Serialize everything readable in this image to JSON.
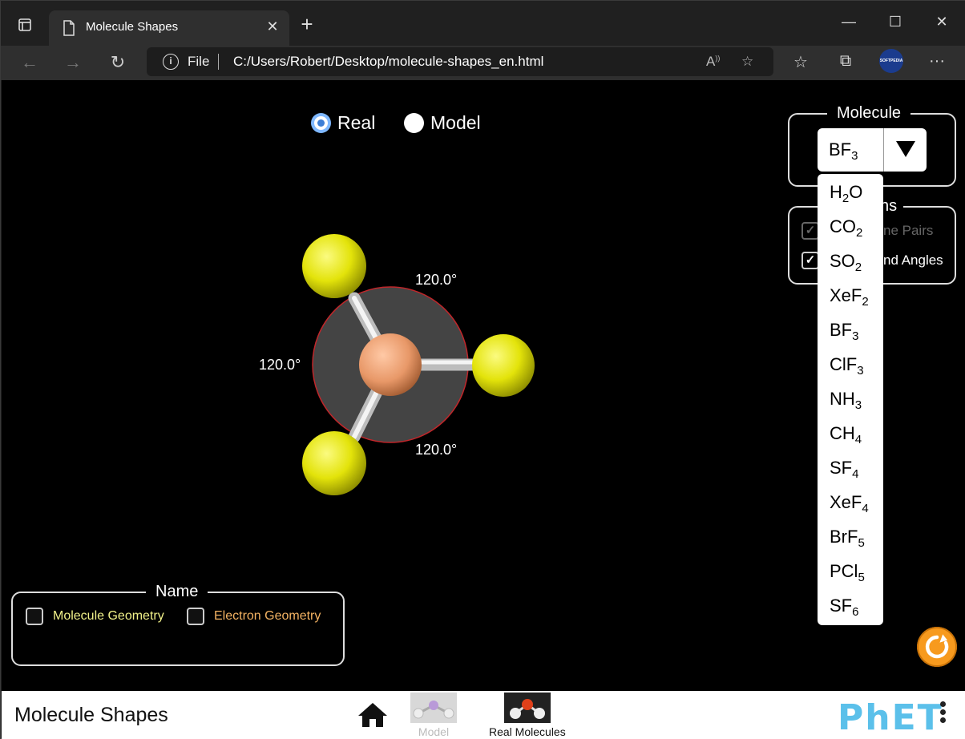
{
  "browser": {
    "tab_title": "Molecule Shapes",
    "new_tab_label": "+",
    "url_scheme_label": "File",
    "url": "C:/Users/Robert/Desktop/molecule-shapes_en.html",
    "profile_label": "SOFTPEDIA"
  },
  "view_mode": {
    "options": [
      "Real",
      "Model"
    ],
    "selected": "Real"
  },
  "molecule": {
    "central_atom": "B",
    "terminal_atoms": "F",
    "angles": [
      "120.0°",
      "120.0°",
      "120.0°"
    ]
  },
  "molecule_panel": {
    "title": "Molecule",
    "selected": {
      "base": "BF",
      "sub": "3"
    },
    "dropdown_options": [
      {
        "base1": "H",
        "sub1": "2",
        "base2": "O"
      },
      {
        "base1": "CO",
        "sub1": "2",
        "base2": ""
      },
      {
        "base1": "SO",
        "sub1": "2",
        "base2": ""
      },
      {
        "base1": "XeF",
        "sub1": "2",
        "base2": ""
      },
      {
        "base1": "BF",
        "sub1": "3",
        "base2": ""
      },
      {
        "base1": "ClF",
        "sub1": "3",
        "base2": ""
      },
      {
        "base1": "NH",
        "sub1": "3",
        "base2": ""
      },
      {
        "base1": "CH",
        "sub1": "4",
        "base2": ""
      },
      {
        "base1": "SF",
        "sub1": "4",
        "base2": ""
      },
      {
        "base1": "XeF",
        "sub1": "4",
        "base2": ""
      },
      {
        "base1": "BrF",
        "sub1": "5",
        "base2": ""
      },
      {
        "base1": "PCl",
        "sub1": "5",
        "base2": ""
      },
      {
        "base1": "SF",
        "sub1": "6",
        "base2": ""
      }
    ]
  },
  "options_panel": {
    "title_visible": "ns",
    "lone_pairs_visible": "ne Pairs",
    "bond_angles_visible": "nd Angles"
  },
  "name_panel": {
    "title": "Name",
    "molecule_geometry": "Molecule Geometry",
    "electron_geometry": "Electron Geometry",
    "molecule_geometry_color": "#f2f28a",
    "electron_geometry_color": "#f4b363"
  },
  "navbar": {
    "sim_title": "Molecule Shapes",
    "screens": [
      "Model",
      "Real Molecules"
    ],
    "brand": "PhET"
  },
  "colors": {
    "terminal_atom": "#e8e812",
    "central_atom": "#f0a070",
    "angle_disc": "#444444",
    "accent_orange": "#f79a1e"
  }
}
